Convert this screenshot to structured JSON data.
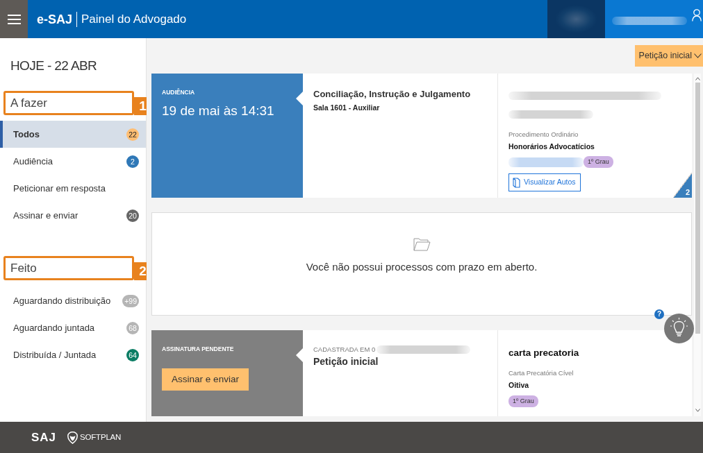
{
  "header": {
    "app_name": "e-SAJ",
    "title": "Painel do Advogado"
  },
  "sidebar": {
    "date": "HOJE - 22 ABR",
    "sections": [
      {
        "title": "A fazer",
        "callout": "1",
        "items": [
          {
            "label": "Todos",
            "count": "22",
            "color": "#ffbe73",
            "selected": true
          },
          {
            "label": "Audiência",
            "count": "2",
            "color": "#2f78b7",
            "selected": false
          },
          {
            "label": "Peticionar em resposta",
            "selected": false
          },
          {
            "label": "Assinar e enviar",
            "count": "20",
            "color": "#666666",
            "selected": false
          }
        ]
      },
      {
        "title": "Feito",
        "callout": "2",
        "items": [
          {
            "label": "Aguardando distribuição",
            "count": "+99",
            "color": "#b5b5b5",
            "selected": false
          },
          {
            "label": "Aguardando juntada",
            "count": "68",
            "color": "#b5b5b5",
            "selected": false
          },
          {
            "label": "Distribuída / Juntada",
            "count": "64",
            "color": "#0b7d64",
            "selected": false
          }
        ]
      }
    ]
  },
  "toolbar": {
    "filter": "Petição inicial"
  },
  "cards": [
    {
      "kind": "hearing",
      "color": "#3a7fbc",
      "category": "AUDIÊNCIA",
      "datetime": "19 de mai às 14:31",
      "title": "Conciliação, Instrução e Julgamento",
      "subtitle": "Sala 1601 - Auxiliar",
      "case_class": "Procedimento Ordinário",
      "case_subject": "Honorários Advocatícios",
      "instance": "1º Grau",
      "button": "Visualizar Autos",
      "corner_count": "2"
    },
    {
      "kind": "empty",
      "message": "Você não possui processos com prazo em aberto."
    },
    {
      "kind": "signature",
      "color": "#808080",
      "category": "ASSINATURA PENDENTE",
      "button": "Assinar e enviar",
      "registered": "CADASTRADA EM 0",
      "title": "Petição inicial",
      "case_title": "carta precatoria",
      "case_class": "Carta Precatória Cível",
      "case_subject": "Oitiva",
      "instance": "1º Grau"
    }
  ],
  "help": "?",
  "footer": {
    "logo": "SAJ",
    "brand": "SOFTPLAN"
  }
}
